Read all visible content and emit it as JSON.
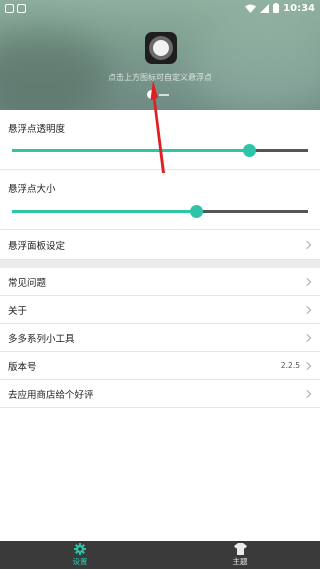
{
  "status_bar": {
    "time": "10:34"
  },
  "hero": {
    "hint": "点击上方图标可自定义悬浮点"
  },
  "sliders": [
    {
      "label": "悬浮点透明度",
      "value_fraction": 0.8
    },
    {
      "label": "悬浮点大小",
      "value_fraction": 0.62
    }
  ],
  "panel_settings": {
    "label": "悬浮面板设定"
  },
  "menu": [
    {
      "label": "常见问题",
      "value": ""
    },
    {
      "label": "关于",
      "value": ""
    },
    {
      "label": "多多系列小工具",
      "value": ""
    },
    {
      "label": "版本号",
      "value": "2.2.5"
    },
    {
      "label": "去应用商店给个好评",
      "value": ""
    }
  ],
  "bottom_tabs": [
    {
      "label": "设置",
      "icon": "gear-icon",
      "active": true
    },
    {
      "label": "主题",
      "icon": "shirt-icon",
      "active": false
    }
  ],
  "colors": {
    "accent": "#2fc4a8",
    "bottom_bar": "#3a3a3a",
    "arrow": "#e02020"
  }
}
